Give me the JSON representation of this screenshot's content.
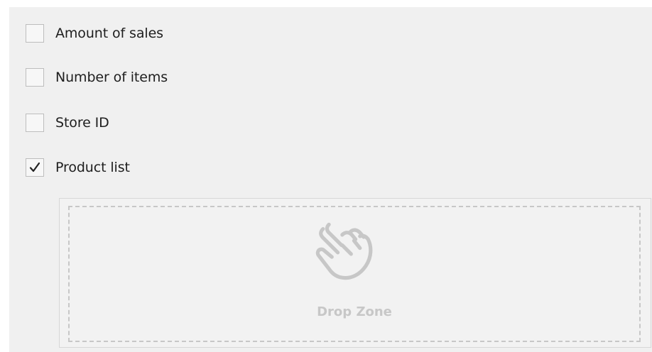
{
  "options": [
    {
      "label": "Amount of sales",
      "checked": false
    },
    {
      "label": "Number of items",
      "checked": false
    },
    {
      "label": "Store ID",
      "checked": false
    },
    {
      "label": "Product list",
      "checked": true
    }
  ],
  "drop_zone": {
    "label": "Drop Zone",
    "icon": "hand-pointer-icon"
  },
  "colors": {
    "panel_background": "#f0f0f0",
    "checkbox_border": "#bdbdbd",
    "drop_border": "#c7c7c7",
    "drop_text": "#c7c7c7",
    "label_text": "#1e1e1e"
  }
}
